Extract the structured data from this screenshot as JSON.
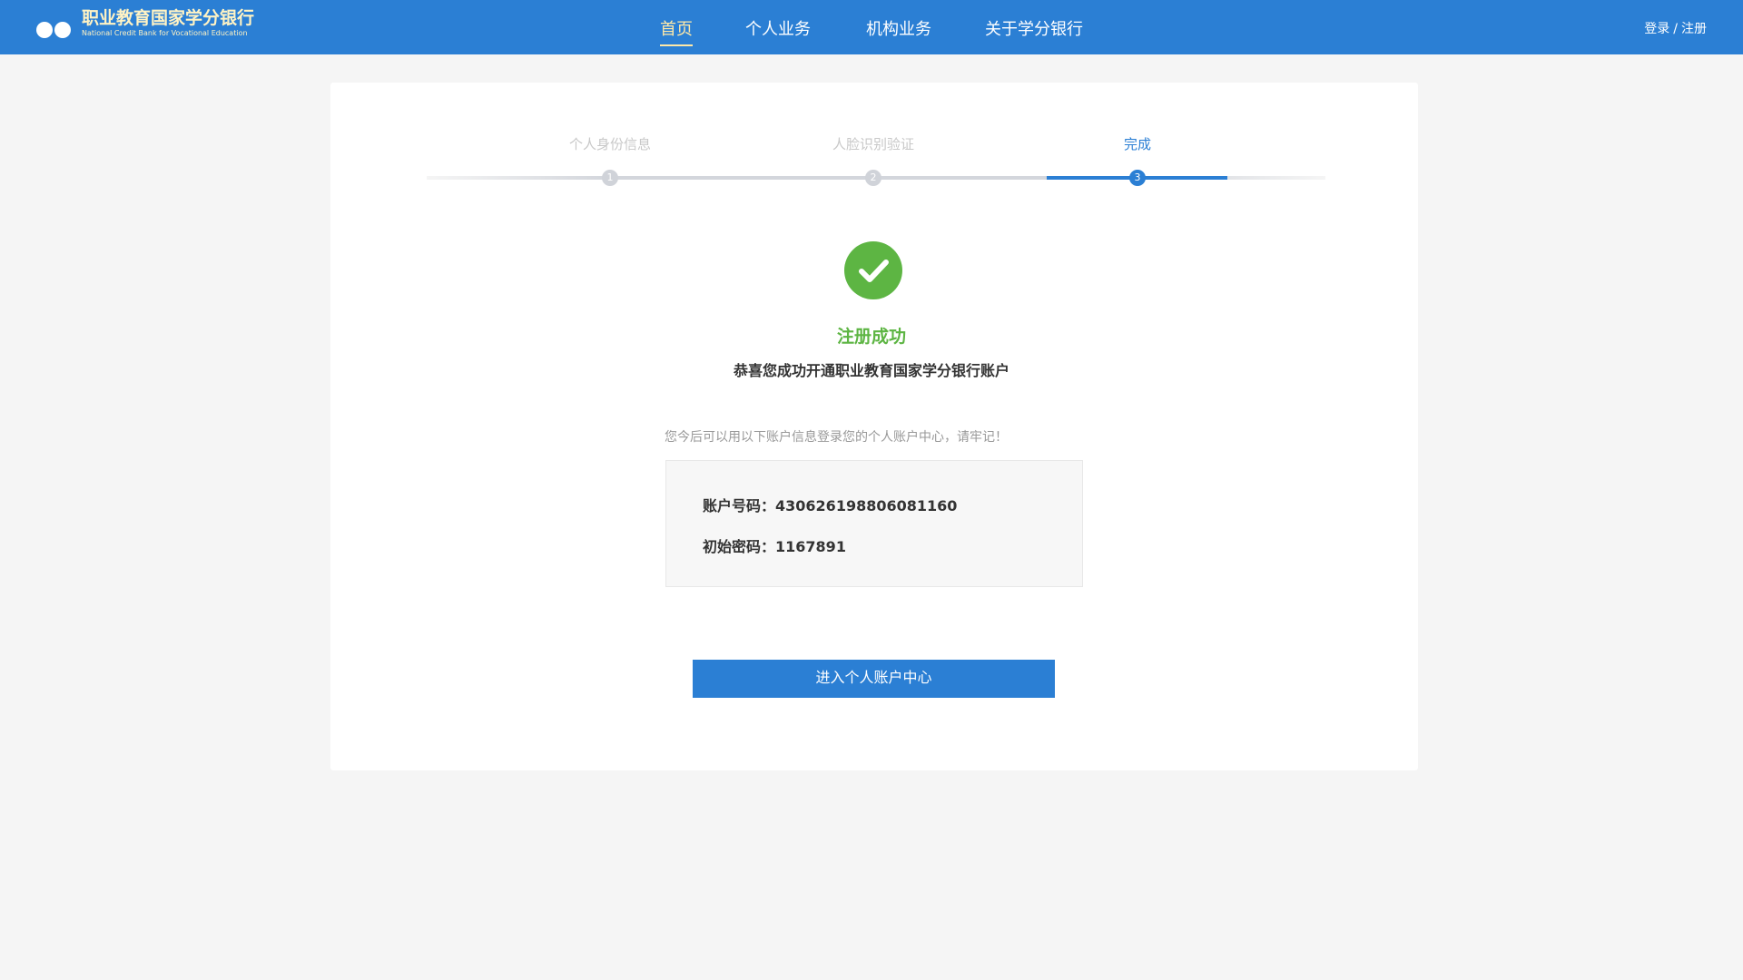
{
  "header": {
    "logo_cn": "职业教育国家学分银行",
    "logo_en": "National Credit Bank for Vocational Education",
    "nav": [
      "首页",
      "个人业务",
      "机构业务",
      "关于学分银行"
    ],
    "login": "登录",
    "separator": "/",
    "register": "注册"
  },
  "steps": [
    {
      "label": "个人身份信息",
      "num": "1"
    },
    {
      "label": "人脸识别验证",
      "num": "2"
    },
    {
      "label": "完成",
      "num": "3"
    }
  ],
  "result": {
    "title": "注册成功",
    "subtitle": "恭喜您成功开通职业教育国家学分银行账户",
    "note": "您今后可以用以下账户信息登录您的个人账户中心，请牢记！",
    "account_label": "账户号码：",
    "account": "430626198806081160",
    "password_label": "初始密码：",
    "password": "1167891"
  },
  "button": "进入个人账户中心",
  "colors": {
    "primary": "#2b7fd4",
    "success": "#5db543"
  }
}
